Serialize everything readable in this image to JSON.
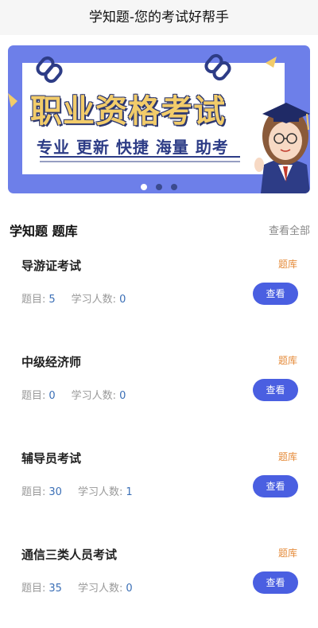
{
  "header": {
    "title": "学知题-您的考试好帮手"
  },
  "banner": {
    "title": "职业资格考试",
    "subtitle": "专业 更新 快捷 海量 助考",
    "slide_count": 3,
    "active_slide": 1
  },
  "section": {
    "title": "学知题 题库",
    "view_all": "查看全部"
  },
  "labels": {
    "questions": "题目:",
    "learners": "学习人数:",
    "tag": "题库",
    "view": "查看"
  },
  "exams": [
    {
      "name": "导游证考试",
      "questions": "5",
      "learners": "0"
    },
    {
      "name": "中级经济师",
      "questions": "0",
      "learners": "0"
    },
    {
      "name": "辅导员考试",
      "questions": "30",
      "learners": "1"
    },
    {
      "name": "通信三类人员考试",
      "questions": "35",
      "learners": "0"
    }
  ],
  "colors": {
    "accent": "#4a5fe1",
    "tag": "#e58b3a",
    "number": "#3b6fb6",
    "banner": "#6d7fe9"
  }
}
